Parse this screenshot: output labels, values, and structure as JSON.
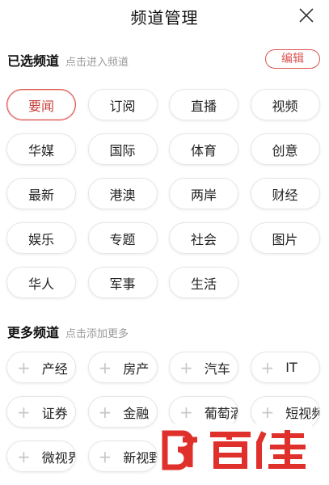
{
  "header": {
    "title": "频道管理",
    "close_icon": "close-icon"
  },
  "selected": {
    "title": "已选频道",
    "hint": "点击进入频道",
    "edit_label": "编辑",
    "channels": [
      "要闻",
      "订阅",
      "直播",
      "视频",
      "华媒",
      "国际",
      "体育",
      "创意",
      "最新",
      "港澳",
      "两岸",
      "财经",
      "娱乐",
      "专题",
      "社会",
      "图片",
      "华人",
      "军事",
      "生活"
    ],
    "active_index": 0
  },
  "more": {
    "title": "更多频道",
    "hint": "点击添加更多",
    "plus_icon": "plus-icon",
    "channels": [
      "产经",
      "房产",
      "汽车",
      "IT",
      "证券",
      "金融",
      "葡萄酒",
      "短视频",
      "微视界",
      "新视野"
    ]
  },
  "watermark": {
    "text": "百佳",
    "logo_icon": "bt-logo-icon"
  },
  "colors": {
    "accent": "#d9534f",
    "watermark_red": "#e0302b"
  }
}
